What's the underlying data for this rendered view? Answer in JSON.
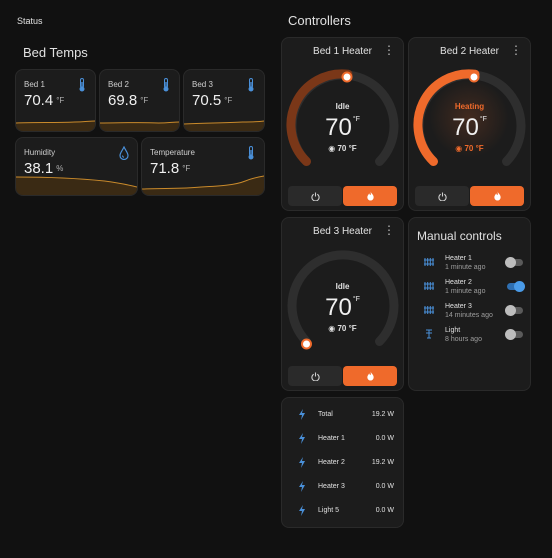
{
  "status": {
    "title": "Status"
  },
  "bed_temps": {
    "title": "Bed Temps",
    "tiles": [
      {
        "label": "Bed 1",
        "value": "70.4",
        "unit": "°F",
        "icon": "thermometer-icon"
      },
      {
        "label": "Bed 2",
        "value": "69.8",
        "unit": "°F",
        "icon": "thermometer-icon"
      },
      {
        "label": "Bed 3",
        "value": "70.5",
        "unit": "°F",
        "icon": "thermometer-icon"
      },
      {
        "label": "Humidity",
        "value": "38.1",
        "unit": "%",
        "icon": "water-drop-icon"
      },
      {
        "label": "Temperature",
        "value": "71.8",
        "unit": "°F",
        "icon": "thermometer-icon"
      }
    ]
  },
  "controllers": {
    "title": "Controllers",
    "heaters": [
      {
        "name": "Bed 1 Heater",
        "status": "Idle",
        "temp": "70",
        "unit": "°F",
        "target": "70 °F",
        "level": 0.55
      },
      {
        "name": "Bed 2 Heater",
        "status": "Heating",
        "temp": "70",
        "unit": "°F",
        "target": "70 °F",
        "level": 0.55
      },
      {
        "name": "Bed 3 Heater",
        "status": "Idle",
        "temp": "70",
        "unit": "°F",
        "target": "70 °F",
        "level": 0.0
      }
    ],
    "menu_glyph": "⋮"
  },
  "manual_controls": {
    "title": "Manual controls",
    "items": [
      {
        "name": "Heater 1",
        "time": "1 minute ago",
        "on": false,
        "icon": "radiator-icon"
      },
      {
        "name": "Heater 2",
        "time": "1 minute ago",
        "on": true,
        "icon": "radiator-icon"
      },
      {
        "name": "Heater 3",
        "time": "14 minutes ago",
        "on": false,
        "icon": "radiator-icon"
      },
      {
        "name": "Light",
        "time": "8 hours ago",
        "on": false,
        "icon": "lamp-icon"
      }
    ]
  },
  "energy": {
    "rows": [
      {
        "label": "Total",
        "value": "19.2 W"
      },
      {
        "label": "Heater 1",
        "value": "0.0 W"
      },
      {
        "label": "Heater 2",
        "value": "19.2 W"
      },
      {
        "label": "Heater 3",
        "value": "0.0 W"
      },
      {
        "label": "Light 5",
        "value": "0.0 W"
      }
    ]
  },
  "colors": {
    "accent": "#ef6a2b",
    "blue": "#4a90d9",
    "idle_arc": "#7a3718",
    "heating_arc": "#ef6a2b",
    "track": "#2e2e2e"
  }
}
